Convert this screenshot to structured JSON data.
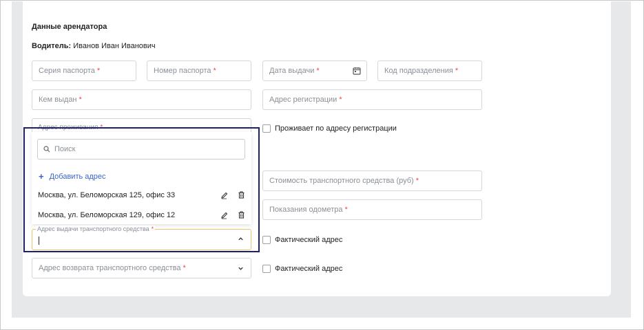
{
  "section": {
    "title": "Данные арендатора",
    "driver_label": "Водитель:",
    "driver_name": "Иванов Иван Иванович"
  },
  "fields": {
    "passport_series": "Серия паспорта",
    "passport_number": "Номер паспорта",
    "issue_date": "Дата выдачи",
    "division_code": "Код подразделения",
    "issued_by": "Кем выдан",
    "registration_address": "Адрес регистрации",
    "residence_address": "Адрес проживания",
    "vehicle_cost": "Стоимость транспортного средства (руб)",
    "odometer": "Показания одометра",
    "pickup_address": "Адрес выдачи транспортного средства",
    "return_address": "Адрес возврата транспортного средства",
    "required_mark": "*"
  },
  "checkboxes": {
    "lives_at_registration": "Проживает по адресу регистрации",
    "actual_address_1": "Фактический адрес",
    "actual_address_2": "Фактический адрес"
  },
  "dropdown": {
    "search_placeholder": "Поиск",
    "add_label": "Добавить адрес",
    "add_symbol": "+",
    "options": [
      {
        "label": "Москва, ул. Беломорская 125, офис 33"
      },
      {
        "label": "Москва, ул. Беломорская 129, офис 12"
      }
    ]
  },
  "icons": {
    "calendar": "calendar-icon",
    "search": "search-icon",
    "edit": "pencil-icon",
    "delete": "trash-icon",
    "chevron_down": "chevron-down-icon",
    "chevron_up": "chevron-up-icon"
  },
  "colors": {
    "accent": "#3a63c9",
    "required": "#e5484d",
    "focus_border": "#e9c46a",
    "highlight_border": "#1d1f6e"
  }
}
